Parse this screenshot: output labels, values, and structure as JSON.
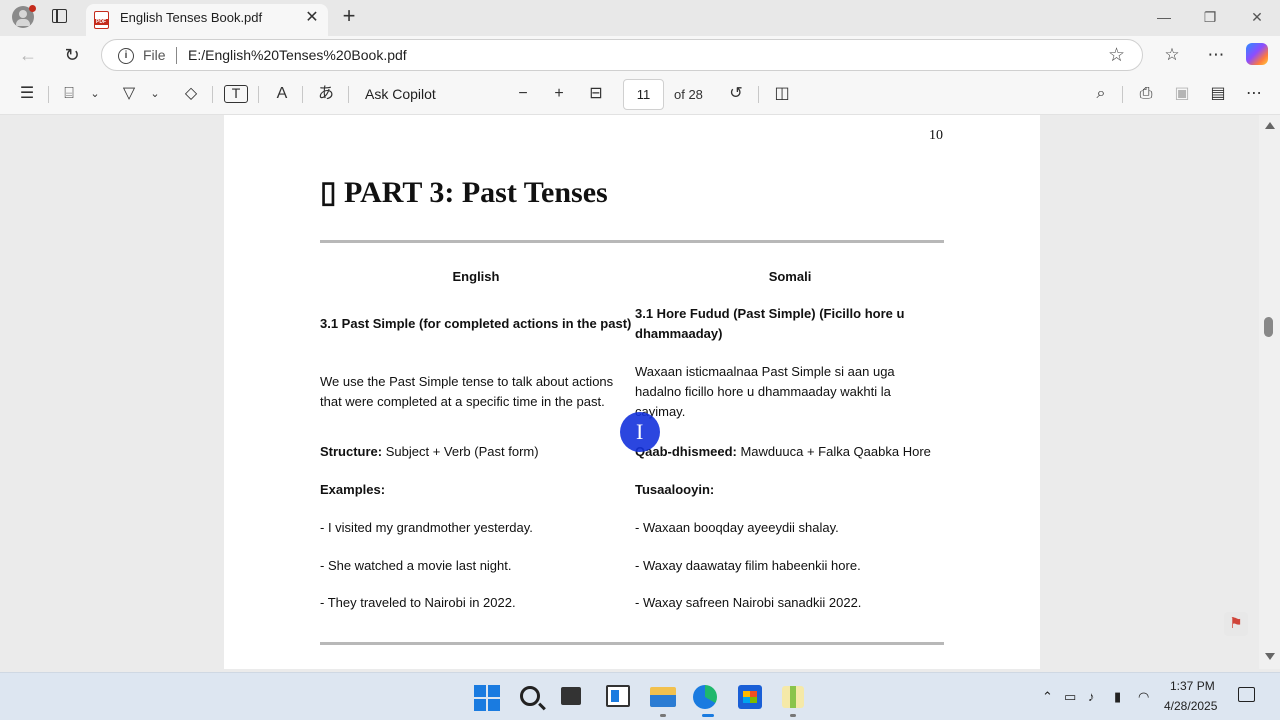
{
  "browser": {
    "tab_title": "English Tenses Book.pdf",
    "address_scheme": "File",
    "address_url": "E:/English%20Tenses%20Book.pdf",
    "window_controls": {
      "minimize": "—",
      "restore": "❐",
      "close": "✕"
    }
  },
  "pdf_toolbar": {
    "ask_copilot": "Ask Copilot",
    "current_page": "11",
    "total_pages": "of 28"
  },
  "page": {
    "number": "10",
    "icon": "▯",
    "heading": "PART 3: Past Tenses",
    "columns": [
      "English",
      "Somali"
    ],
    "rows": [
      {
        "english": "3.1 Past Simple (for completed actions in the past)",
        "somali": "3.1 Hore Fudud (Past Simple) (Ficillo hore u dhammaaday)",
        "bold": true
      },
      {
        "english": "We use the Past Simple tense to talk about actions that were completed at a specific time in the past.",
        "somali": "Waxaan isticmaalnaa Past Simple si aan uga hadalno ficillo hore u dhammaaday wakhti la cayimay."
      },
      {
        "english_label": "Structure:",
        "english": " Subject + Verb (Past form)",
        "somali_label": "Qaab-dhismeed:",
        "somali": " Mawduuca + Falka Qaabka Hore"
      },
      {
        "english": "Examples:",
        "somali": "Tusaalooyin:",
        "bold": true
      },
      {
        "english": "- I visited my grandmother yesterday.",
        "somali": "- Waxaan booqday ayeeydii shalay."
      },
      {
        "english": "- She watched a movie last night.",
        "somali": "- Waxay daawatay filim habeenkii hore."
      },
      {
        "english": "- They traveled to Nairobi in 2022.",
        "somali": "- Waxay safreen Nairobi sanadkii 2022."
      }
    ]
  },
  "taskbar": {
    "time": "1:37 PM",
    "date": "4/28/2025"
  },
  "colors": {
    "accent": "#1a7be0",
    "pdf_red": "#c42b1c",
    "cursor": "#1432dc"
  }
}
